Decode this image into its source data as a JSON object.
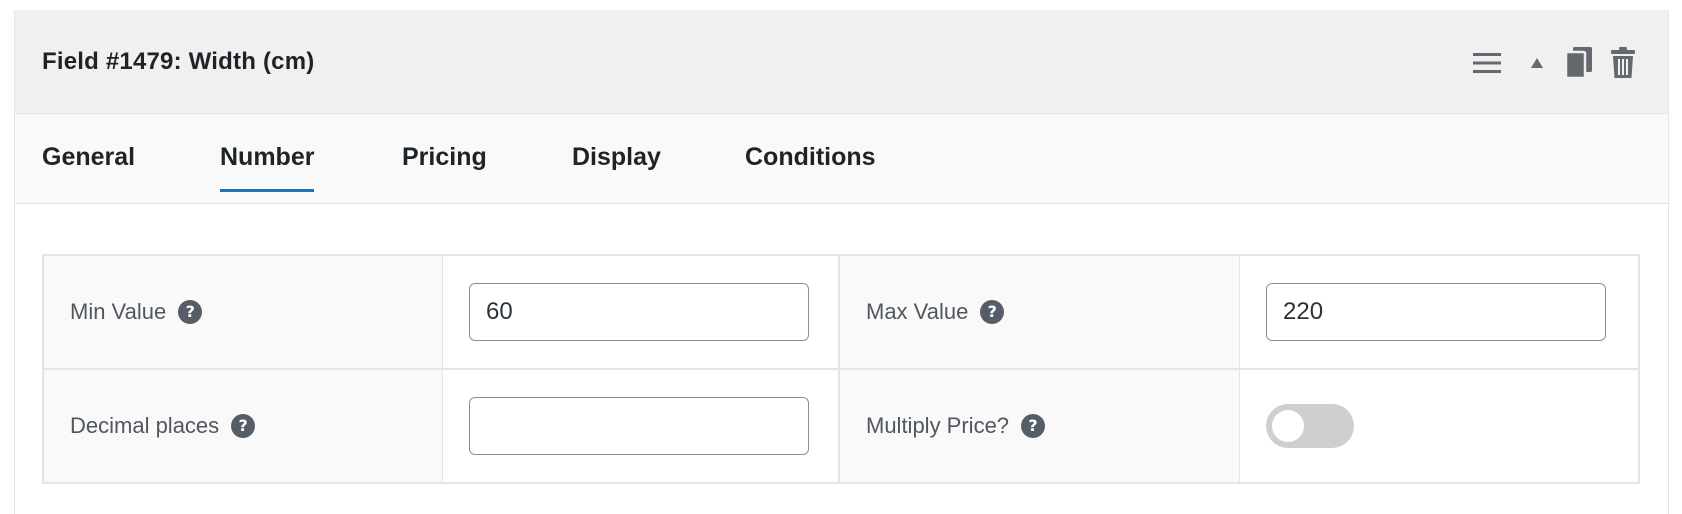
{
  "header": {
    "title": "Field #1479: Width (cm)",
    "icons": [
      "menu-icon",
      "collapse-arrow-icon",
      "duplicate-icon",
      "trash-icon"
    ]
  },
  "tabs": [
    {
      "label": "General",
      "active": false
    },
    {
      "label": "Number",
      "active": true
    },
    {
      "label": "Pricing",
      "active": false
    },
    {
      "label": "Display",
      "active": false
    },
    {
      "label": "Conditions",
      "active": false
    }
  ],
  "fields": {
    "min_value": {
      "label": "Min Value",
      "value": "60"
    },
    "max_value": {
      "label": "Max Value",
      "value": "220"
    },
    "decimal_places": {
      "label": "Decimal places",
      "value": ""
    },
    "multiply_price": {
      "label": "Multiply Price?",
      "enabled": false
    }
  },
  "help_glyph": "?",
  "colors": {
    "active_tab_underline": "#2271b1",
    "header_bg": "#f0f0f1",
    "toggle_off": "#cfcfcf",
    "icon": "#555d66"
  }
}
